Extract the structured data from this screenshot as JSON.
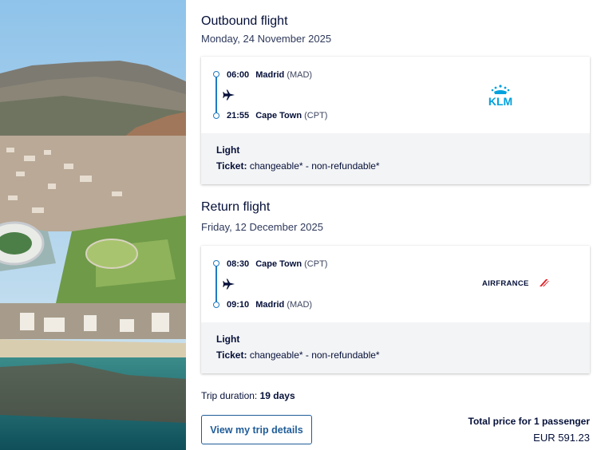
{
  "outbound": {
    "title": "Outbound flight",
    "date": "Monday, 24 November 2025",
    "departure": {
      "time": "06:00",
      "city": "Madrid",
      "code": "(MAD)"
    },
    "arrival": {
      "time": "21:55",
      "city": "Cape Town",
      "code": "(CPT)"
    },
    "airline_logo": "KLM",
    "fare": "Light",
    "ticket_label": "Ticket:",
    "ticket_value": "changeable* - non-refundable*"
  },
  "return": {
    "title": "Return flight",
    "date": "Friday, 12 December 2025",
    "departure": {
      "time": "08:30",
      "city": "Cape Town",
      "code": "(CPT)"
    },
    "arrival": {
      "time": "09:10",
      "city": "Madrid",
      "code": "(MAD)"
    },
    "airline_logo": "AIRFRANCE",
    "fare": "Light",
    "ticket_label": "Ticket:",
    "ticket_value": "changeable* - non-refundable*"
  },
  "summary": {
    "duration_label": "Trip duration:",
    "duration_value": "19 days",
    "details_button": "View my trip details",
    "total_label": "Total price for 1 passenger",
    "total_price": "EUR 591.23"
  },
  "colors": {
    "accent": "#1f7ac3",
    "text": "#051039",
    "klm_blue": "#00a1de",
    "airfrance_red": "#e21f26"
  },
  "icons": [
    "plane-icon",
    "klm-logo",
    "airfrance-logo"
  ]
}
